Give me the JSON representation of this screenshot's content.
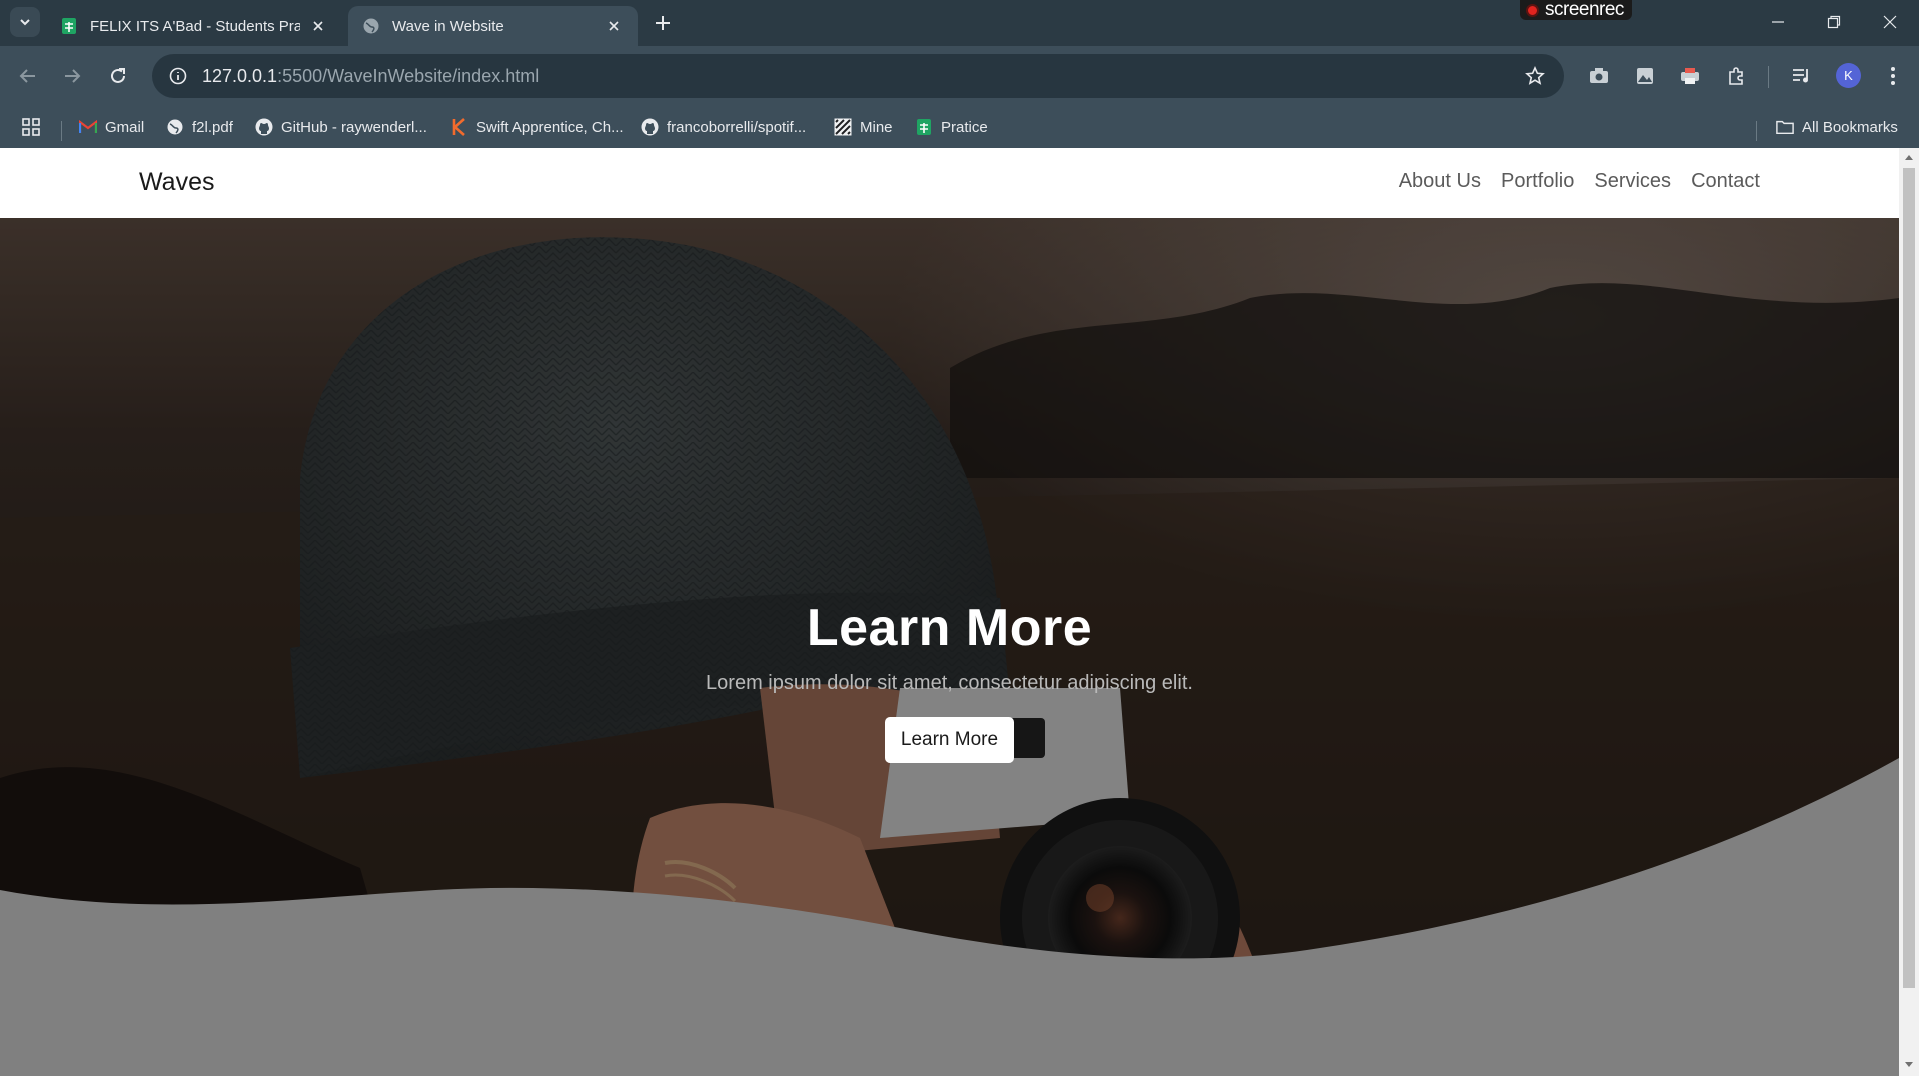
{
  "browser": {
    "tabs": [
      {
        "title": "FELIX ITS A'Bad - Students Pract",
        "favicon": "sheets-icon",
        "active": false
      },
      {
        "title": "Wave in Website",
        "favicon": "globe-icon",
        "active": true
      }
    ],
    "screenrec_label": "screenrec",
    "url_host": "127.0.0.1",
    "url_path": ":5500/WaveInWebsite/index.html",
    "avatar_letter": "K",
    "bookmarks": [
      {
        "label": "Gmail",
        "icon": "gmail-icon"
      },
      {
        "label": "f2l.pdf",
        "icon": "globe-icon"
      },
      {
        "label": "GitHub - raywenderl...",
        "icon": "github-icon"
      },
      {
        "label": "Swift Apprentice, Ch...",
        "icon": "kodeco-icon"
      },
      {
        "label": "francoborrelli/spotif...",
        "icon": "github-icon"
      },
      {
        "label": "Mine",
        "icon": "striped-icon"
      },
      {
        "label": "Pratice",
        "icon": "sheets-icon"
      }
    ],
    "all_bookmarks_label": "All Bookmarks"
  },
  "site": {
    "brand": "Waves",
    "nav": [
      "About Us",
      "Portfolio",
      "Services",
      "Contact"
    ],
    "hero": {
      "title": "Learn More",
      "subtitle": "Lorem ipsum dolor sit amet, consectetur adipiscing elit.",
      "button_label": "Learn More"
    },
    "colors": {
      "wave_fill": "#808080",
      "nav_bg": "#ffffff",
      "browser_frame": "#3d4e5a"
    }
  }
}
